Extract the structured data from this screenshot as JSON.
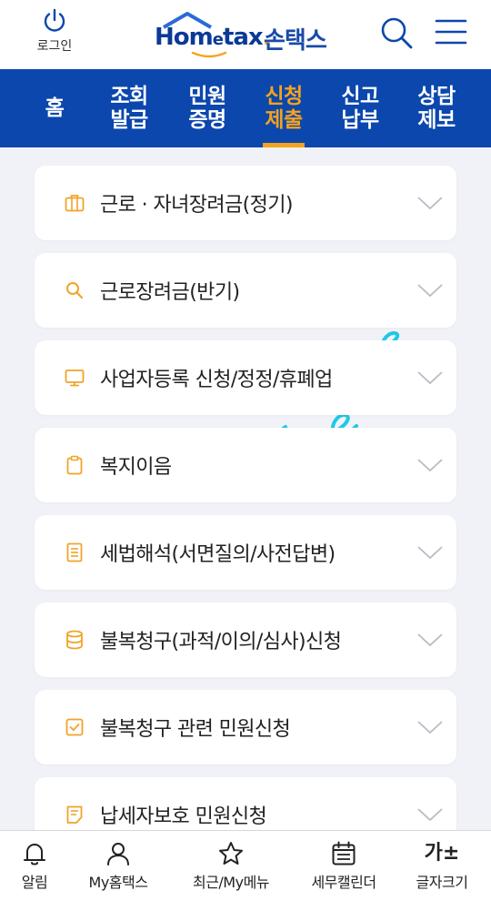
{
  "header": {
    "login_label": "로그인",
    "logo_text_pre": "Hom",
    "logo_text_e": "e",
    "logo_text_post": "tax",
    "logo_dot": ".",
    "logo_korean": "손택스"
  },
  "nav": {
    "items": [
      {
        "label": "홈",
        "active": false
      },
      {
        "label": "조회\n발급",
        "active": false
      },
      {
        "label": "민원\n증명",
        "active": false
      },
      {
        "label": "신청\n제출",
        "active": true
      },
      {
        "label": "신고\n납부",
        "active": false
      },
      {
        "label": "상담\n제보",
        "active": false
      }
    ]
  },
  "cards": [
    {
      "title": "근로 · 자녀장려금(정기)",
      "icon": "briefcase-icon"
    },
    {
      "title": "근로장려금(반기)",
      "icon": "search-icon"
    },
    {
      "title": "사업자등록 신청/정정/휴폐업",
      "icon": "monitor-icon"
    },
    {
      "title": "복지이음",
      "icon": "clipboard-icon"
    },
    {
      "title": "세법해석(서면질의/사전답변)",
      "icon": "document-icon"
    },
    {
      "title": "불복청구(과적/이의/심사)신청",
      "icon": "database-icon"
    },
    {
      "title": "불복청구 관련 민원신청",
      "icon": "checkbox-icon"
    },
    {
      "title": "납세자보호 민원신청",
      "icon": "note-icon"
    }
  ],
  "bottom_nav": [
    {
      "label": "알림",
      "icon": "bell-icon"
    },
    {
      "label": "My홈택스",
      "icon": "user-icon"
    },
    {
      "label": "최근/My메뉴",
      "icon": "star-icon"
    },
    {
      "label": "세무캘린더",
      "icon": "calendar-icon"
    },
    {
      "label": "글자크기",
      "icon": "font-size-icon",
      "glyph": "가±"
    }
  ],
  "colors": {
    "brand_blue": "#0b47ac",
    "accent_orange": "#f6a21c",
    "annotation_cyan": "#1ec8e6"
  }
}
